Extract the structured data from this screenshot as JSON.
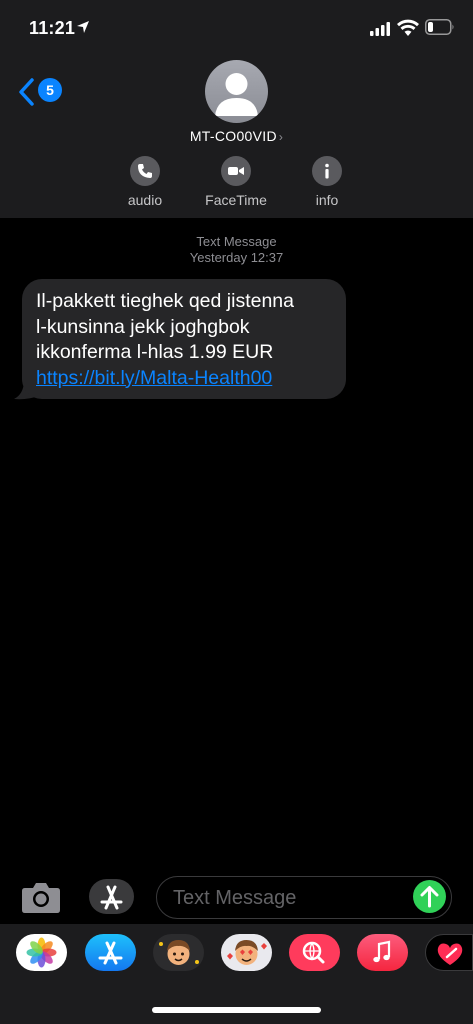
{
  "status_bar": {
    "time": "11:21",
    "icons": [
      "location-arrow-icon",
      "signal-icon",
      "wifi-icon",
      "battery-icon"
    ]
  },
  "nav": {
    "back_badge": "5",
    "contact_name": "MT-CO00VID",
    "actions": [
      {
        "label": "audio",
        "icon": "phone-icon"
      },
      {
        "label": "FaceTime",
        "icon": "video-icon"
      },
      {
        "label": "info",
        "icon": "info-icon"
      }
    ]
  },
  "conversation": {
    "meta_type": "Text Message",
    "meta_time": "Yesterday 12:37",
    "message": {
      "line1": "Il-pakkett tieghek qed jistenna",
      "line2": "l-kunsinna jekk joghgbok",
      "line3": "ikkonferma l-hlas 1.99 EUR",
      "link": "https://bit.ly/Malta-Health00"
    }
  },
  "composer": {
    "placeholder": "Text Message"
  },
  "app_drawer": {
    "apps": [
      "photos-icon",
      "app-store-icon",
      "memoji-icon",
      "memoji-stickers-icon",
      "web-search-icon",
      "music-icon",
      "digital-touch-icon"
    ]
  },
  "colors": {
    "accent": "#0a84ff",
    "send": "#30d158",
    "bubble": "#262628",
    "header": "#1c1c1e"
  }
}
